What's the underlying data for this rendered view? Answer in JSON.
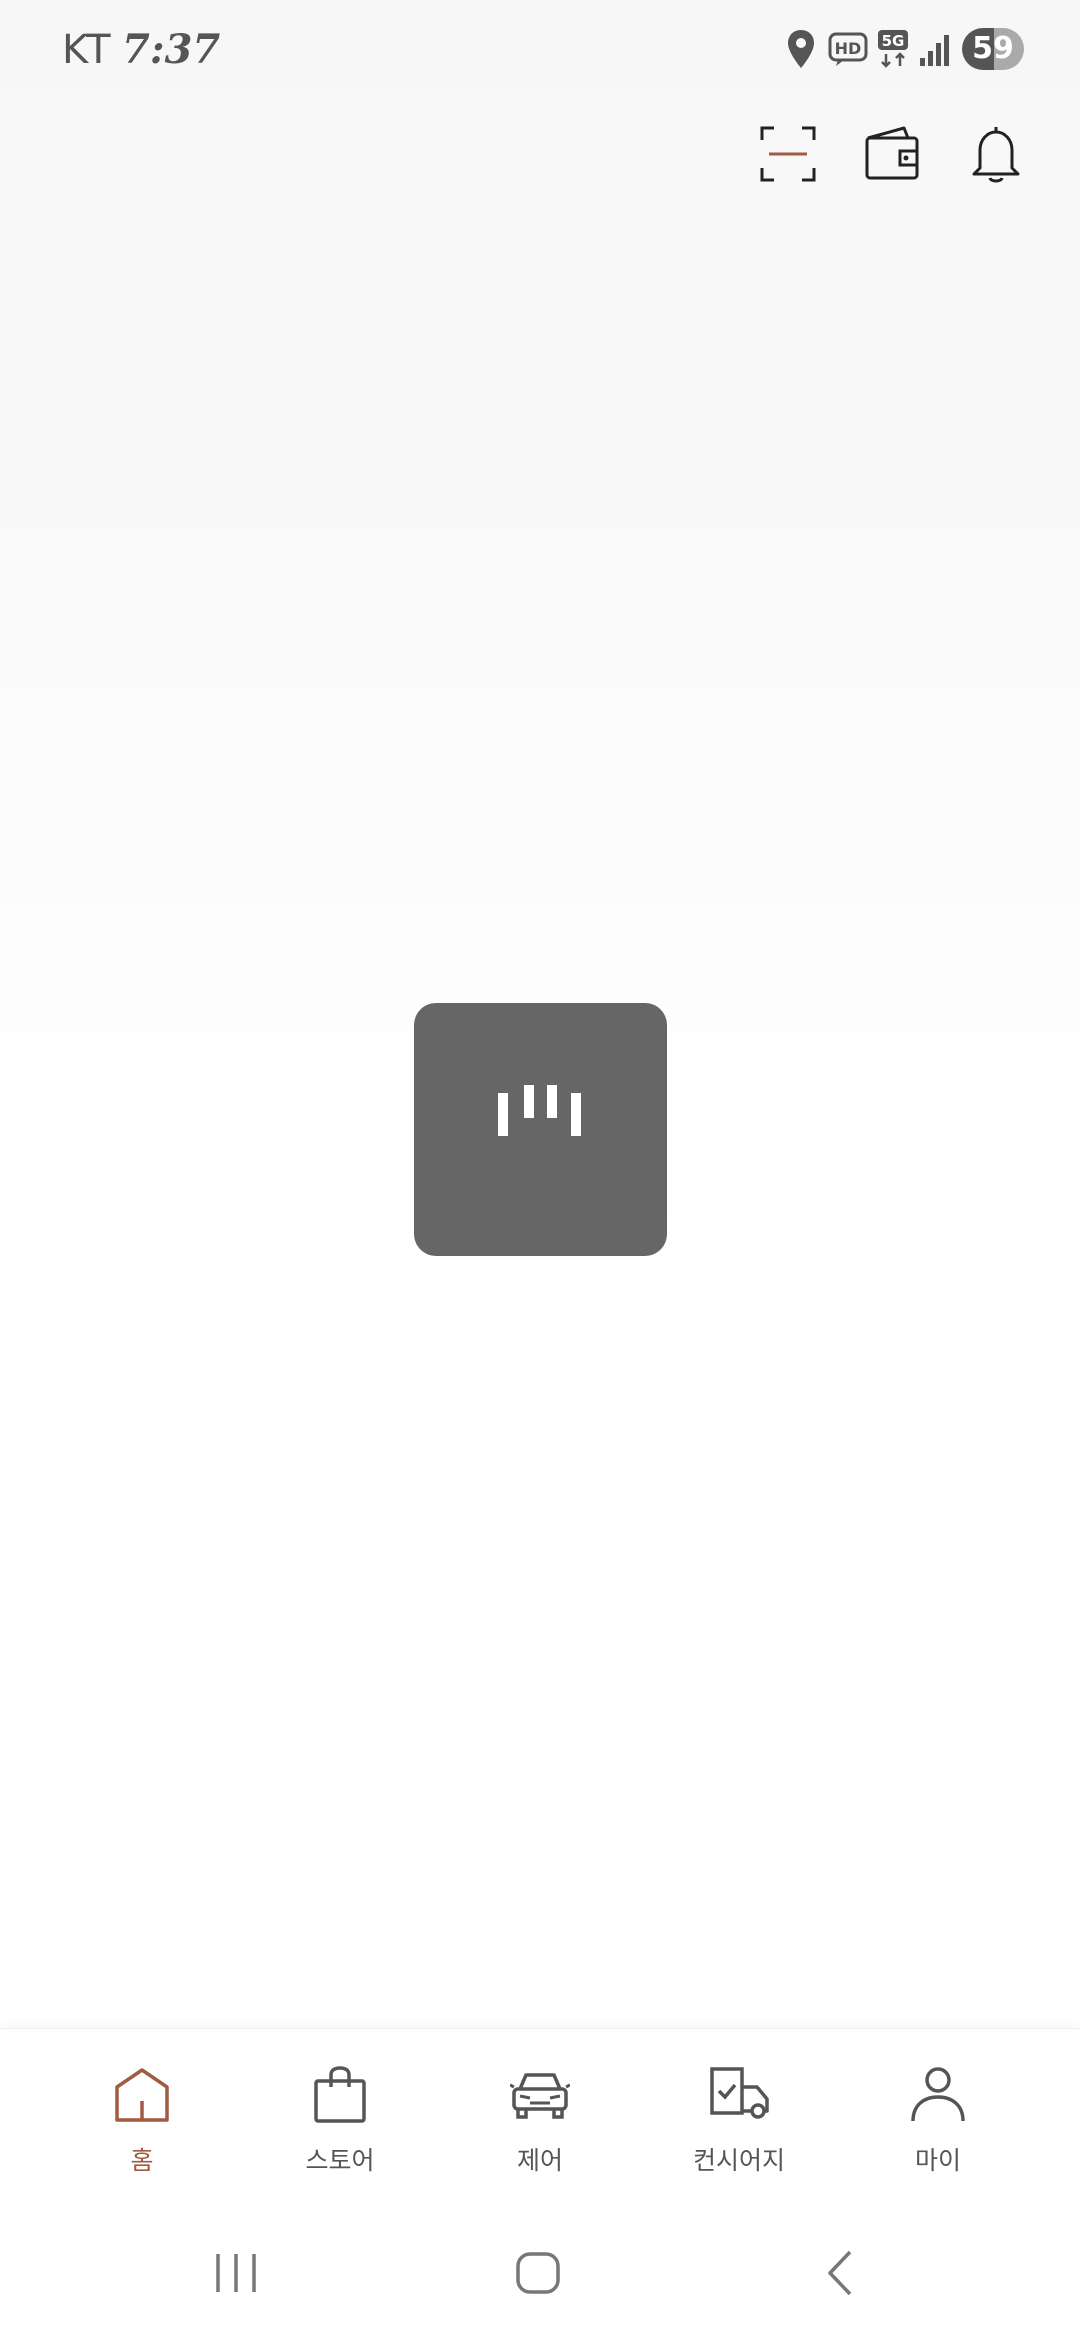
{
  "status_bar": {
    "carrier": "KT",
    "time": "7:37",
    "battery": "59",
    "icons": [
      "location-icon",
      "hd-voice-icon",
      "5g-data-icon",
      "signal-icon",
      "battery-icon"
    ]
  },
  "toolbar": {
    "icons": [
      "qr-scan-icon",
      "wallet-icon",
      "bell-icon"
    ]
  },
  "loader": {
    "icon": "loading-bars-icon"
  },
  "bottom_nav": {
    "active_color": "#a15b41",
    "inactive_color": "#555555",
    "items": [
      {
        "label": "홈",
        "icon": "home-icon",
        "active": true
      },
      {
        "label": "스토어",
        "icon": "shopping-bag-icon",
        "active": false
      },
      {
        "label": "제어",
        "icon": "car-icon",
        "active": false
      },
      {
        "label": "컨시어지",
        "icon": "concierge-truck-icon",
        "active": false
      },
      {
        "label": "마이",
        "icon": "person-icon",
        "active": false
      }
    ]
  },
  "system_nav": {
    "icons": [
      "recent-apps-icon",
      "home-button-icon",
      "back-icon"
    ]
  }
}
